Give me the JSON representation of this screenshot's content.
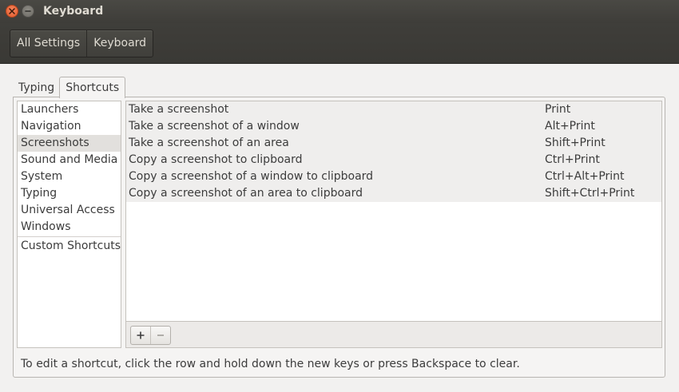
{
  "window": {
    "title": "Keyboard"
  },
  "breadcrumb": {
    "items": [
      "All Settings",
      "Keyboard"
    ]
  },
  "tabs": [
    {
      "label": "Typing",
      "active": false
    },
    {
      "label": "Shortcuts",
      "active": true
    }
  ],
  "categories": {
    "items": [
      "Launchers",
      "Navigation",
      "Screenshots",
      "Sound and Media",
      "System",
      "Typing",
      "Universal Access",
      "Windows"
    ],
    "selected": "Screenshots",
    "custom": "Custom Shortcuts"
  },
  "shortcuts": [
    {
      "name": "Take a screenshot",
      "accel": "Print"
    },
    {
      "name": "Take a screenshot of a window",
      "accel": "Alt+Print"
    },
    {
      "name": "Take a screenshot of an area",
      "accel": "Shift+Print"
    },
    {
      "name": "Copy a screenshot to clipboard",
      "accel": "Ctrl+Print"
    },
    {
      "name": "Copy a screenshot of a window to clipboard",
      "accel": "Ctrl+Alt+Print"
    },
    {
      "name": "Copy a screenshot of an area to clipboard",
      "accel": "Shift+Ctrl+Print"
    }
  ],
  "toolbar": {
    "add_icon": "plus-icon",
    "remove_icon": "minus-icon"
  },
  "hint": "To edit a shortcut, click the row and hold down the new keys or press Backspace to clear.",
  "colors": {
    "titlebar": "#3e3d39",
    "close_button": "#e05a2b",
    "selected_row": "#e2e0dd"
  }
}
